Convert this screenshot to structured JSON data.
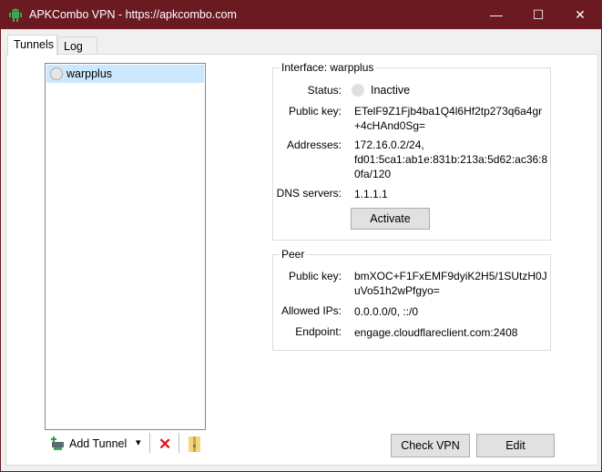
{
  "window": {
    "title": "APKCombo VPN - https://apkcombo.com",
    "minimize": "—",
    "maximize": "☐",
    "close": "✕"
  },
  "tabs": [
    {
      "label": "Tunnels"
    },
    {
      "label": "Log"
    }
  ],
  "tunnels": [
    {
      "name": "warpplus",
      "selected": true
    }
  ],
  "toolbar": {
    "add_tunnel": "Add Tunnel",
    "dropdown": "▾",
    "delete": "✕"
  },
  "interface": {
    "title": "Interface: warpplus",
    "status_label": "Status:",
    "status": "Inactive",
    "public_key_label": "Public key:",
    "public_key_1": "ETelF9Z1Fjb4ba1Q4l6Hf2tp273q6a4gr",
    "public_key_2": "+4cHAnd0Sg=",
    "addresses_label": "Addresses:",
    "addresses_1": "172.16.0.2/24,",
    "addresses_2": "fd01:5ca1:ab1e:831b:213a:5d62:ac36:8",
    "addresses_3": "0fa/120",
    "dns_label": "DNS servers:",
    "dns": "1.1.1.1",
    "activate": "Activate"
  },
  "peer": {
    "title": "Peer",
    "public_key_label": "Public key:",
    "public_key_1": "bmXOC+F1FxEMF9dyiK2H5/1SUtzH0J",
    "public_key_2": "uVo51h2wPfgyo=",
    "allowed_ips_label": "Allowed IPs:",
    "allowed_ips": "0.0.0.0/0, ::/0",
    "endpoint_label": "Endpoint:",
    "endpoint": "engage.cloudflareclient.com:2408"
  },
  "buttons": {
    "check_vpn": "Check VPN",
    "edit": "Edit"
  },
  "colors": {
    "titlebar": "#6b1a22",
    "selection": "#cce8ff"
  }
}
